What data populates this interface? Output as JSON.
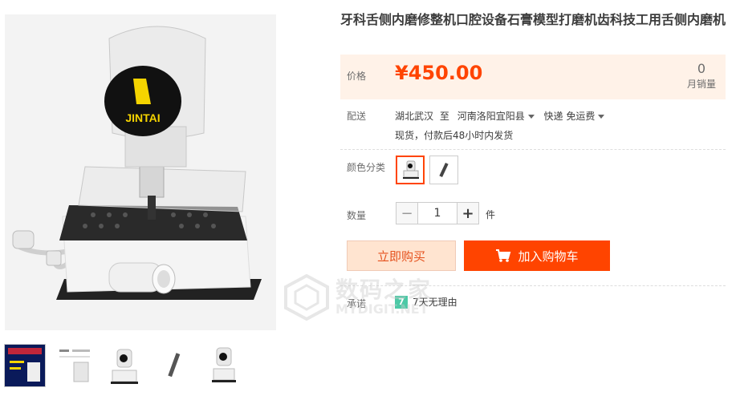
{
  "product": {
    "title": "牙科舌侧内磨修整机口腔设备石膏模型打磨机齿科技工用舌侧内磨机",
    "price_label": "价格",
    "price": "¥450.00",
    "monthly_sales": "0",
    "monthly_sales_label": "月销量"
  },
  "main_image": {
    "brand_text": "JINTAI"
  },
  "delivery": {
    "label": "配送",
    "from": "湖北武汉",
    "to_word": "至",
    "destination": "河南洛阳宜阳县",
    "shipping": "快递 免运费",
    "stock_note": "现货，付款后48小时内发货"
  },
  "color": {
    "label": "颜色分类"
  },
  "quantity": {
    "label": "数量",
    "value": "1",
    "minus": "−",
    "plus": "+",
    "unit": "件"
  },
  "actions": {
    "buy_now": "立即购买",
    "add_to_cart": "加入购物车"
  },
  "promise": {
    "label": "承诺",
    "badge": "7",
    "text": "7天无理由"
  },
  "watermark": {
    "cn": "数码之家",
    "en": "MYDIGIT.NET"
  },
  "colors": {
    "accent": "#ff4400",
    "price_bg": "#fff2e8"
  }
}
